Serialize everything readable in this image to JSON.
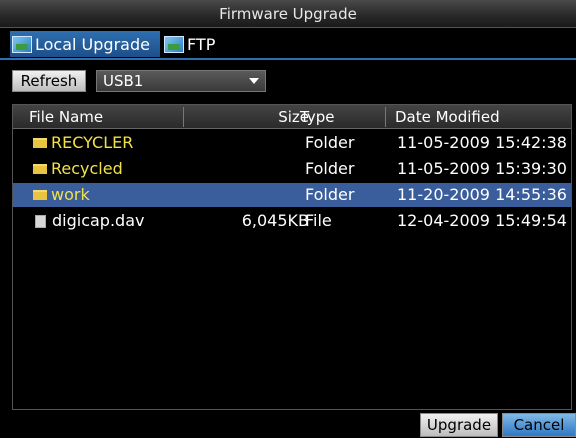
{
  "window": {
    "title": "Firmware Upgrade"
  },
  "tabs": [
    {
      "label": "Local Upgrade",
      "icon": "picture-icon",
      "active": true
    },
    {
      "label": "FTP",
      "icon": "picture-icon",
      "active": false
    }
  ],
  "toolbar": {
    "refresh_label": "Refresh",
    "device": {
      "selected": "USB1"
    }
  },
  "table": {
    "columns": [
      "File Name",
      "Size",
      "Type",
      "Date Modified"
    ],
    "rows": [
      {
        "name": "RECYCLER",
        "size": "",
        "type": "Folder",
        "date": "11-05-2009 15:42:38",
        "kind": "folder",
        "color": "#f2e14a"
      },
      {
        "name": "Recycled",
        "size": "",
        "type": "Folder",
        "date": "11-05-2009 15:39:30",
        "kind": "folder",
        "color": "#f2e14a"
      },
      {
        "name": "work",
        "size": "",
        "type": "Folder",
        "date": "11-20-2009 14:55:36",
        "kind": "folder",
        "color": "#f2e14a",
        "selected": true
      },
      {
        "name": "digicap.dav",
        "size": "6,045KB",
        "type": "File",
        "date": "12-04-2009 15:49:54",
        "kind": "file",
        "color": "#ffffff"
      }
    ]
  },
  "footer": {
    "upgrade_label": "Upgrade",
    "cancel_label": "Cancel"
  },
  "colors": {
    "accent": "#2e6fb0",
    "selected_row": "#3a5d9c",
    "folder_text": "#f2e14a"
  }
}
